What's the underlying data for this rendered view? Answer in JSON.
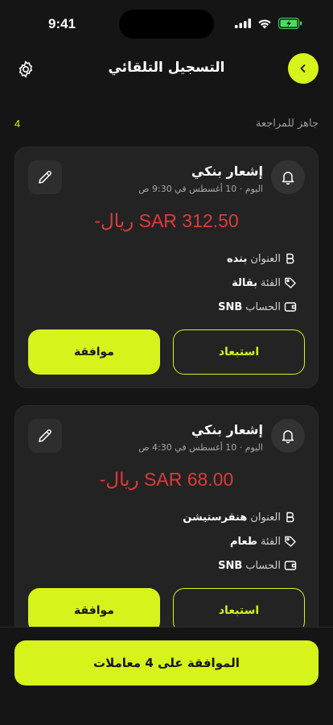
{
  "status_bar": {
    "time": "9:41"
  },
  "header": {
    "title": "التسجيل التلقائي"
  },
  "ready": {
    "label": "جاهز للمراجعة",
    "count": "4"
  },
  "cards": [
    {
      "source_title": "إشعار بنكي",
      "date": "اليوم · 10 أغسطس في 9:30 ص",
      "amount": "-ريال SAR 312.50",
      "title_label": "العنوان",
      "title_value": "بنده",
      "category_label": "الفئة",
      "category_value": "بقالة",
      "account_label": "الحساب",
      "account_value": "SNB",
      "reject_label": "استبعاد",
      "approve_label": "موافقة"
    },
    {
      "source_title": "إشعار بنكي",
      "date": "اليوم · 10 أغسطس في 4:30 ص",
      "amount": "-ريال SAR 68.00",
      "title_label": "العنوان",
      "title_value": "هنقرستيشن",
      "category_label": "الفئة",
      "category_value": "طعام",
      "account_label": "الحساب",
      "account_value": "SNB",
      "reject_label": "استبعاد",
      "approve_label": "موافقة"
    }
  ],
  "footer": {
    "approve_all_label": "الموافقة على 4 معاملات"
  },
  "colors": {
    "accent": "#d6f31c",
    "negative": "#e03a3a",
    "background": "#151515",
    "card": "#232323"
  }
}
